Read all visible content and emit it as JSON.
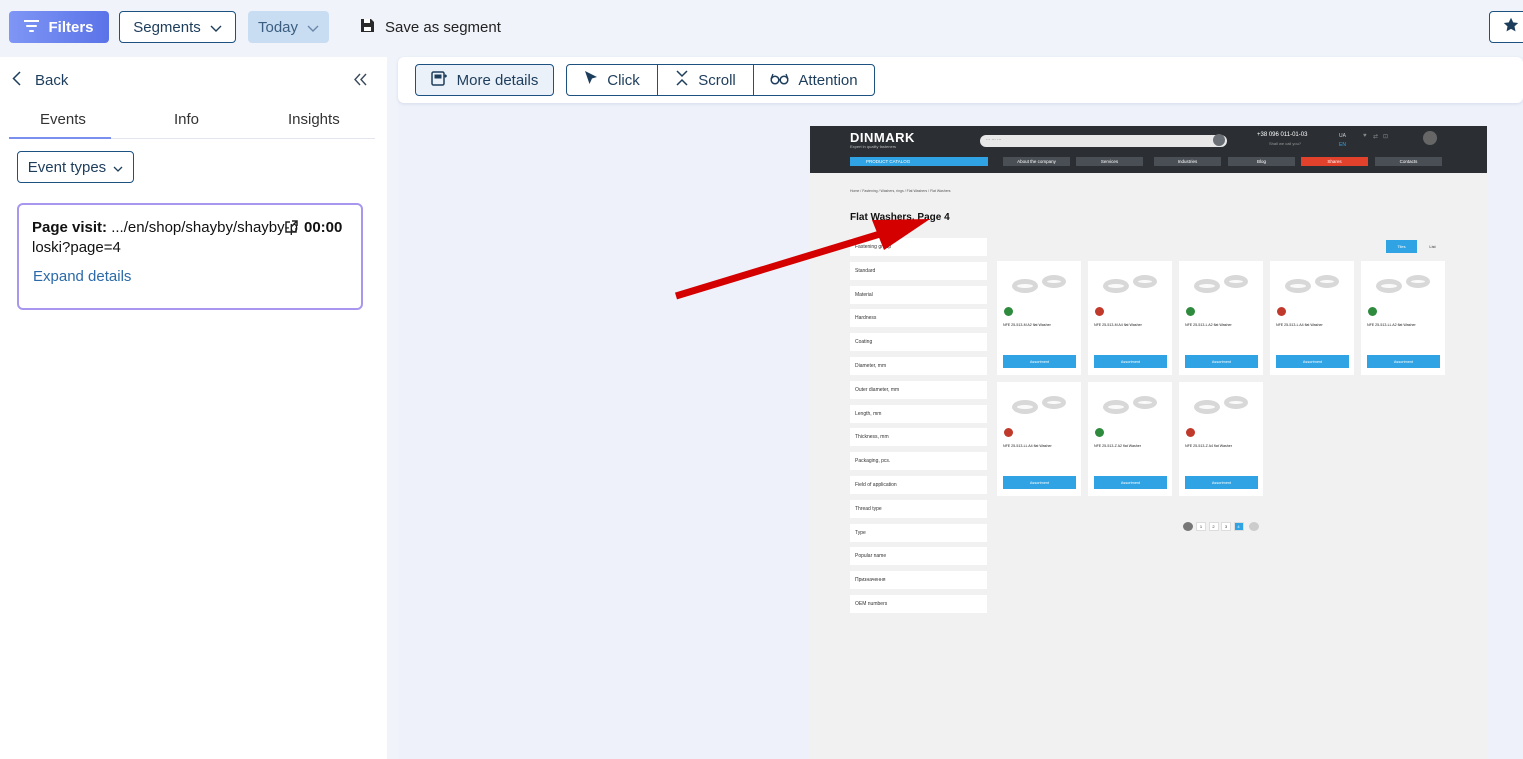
{
  "topbar": {
    "filters_label": "Filters",
    "segments_label": "Segments",
    "today_label": "Today",
    "save_segment_label": "Save as segment"
  },
  "left": {
    "back_label": "Back",
    "tabs": [
      "Events",
      "Info",
      "Insights"
    ],
    "active_tab": "Events",
    "event_types_label": "Event types",
    "event": {
      "prefix": "Page visit:",
      "url": " .../en/shop/shayby/shayby-p",
      "url_cont": "loski?page=4",
      "time": "00:00",
      "expand_label": "Expand details"
    }
  },
  "toolbar": {
    "more_details_label": "More details",
    "click_label": "Click",
    "scroll_label": "Scroll",
    "attention_label": "Attention"
  },
  "site": {
    "logo": "DINMARK",
    "logo_sub": "Expert in quality fasteners",
    "search_placeholder": "... ... ...",
    "phone": "+38 096 011-01-03",
    "phone_sub": "Shall we call you?",
    "lang_ua": "UA",
    "lang_en": "EN",
    "catalog_label": "PRODUCT CATALOG",
    "nav": [
      "About the company",
      "Services",
      "Industries",
      "Blog",
      "Shares",
      "Contacts"
    ],
    "breadcrumbs": "Home / Fastening / Washers, rings / Flat Washers / Flat Washers",
    "page_title": "Flat Washers. Page 4",
    "filters": [
      "Fastening group",
      "Standard",
      "Material",
      "Hardness",
      "Coating",
      "Diameter, mm",
      "Outer diameter, mm",
      "Length, mm",
      "Thickness, mm",
      "Packaging, pcs.",
      "Field of application",
      "Thread type",
      "Type",
      "Popular name",
      "Призначення",
      "OEM numbers"
    ],
    "tiles_label": "Tiles",
    "list_label": "List",
    "products": [
      {
        "name": "NFE 25-513-M A2 flat Washer",
        "badge": "A2",
        "badge_color": "#2e8b3e",
        "button": "Assortment"
      },
      {
        "name": "NFE 25-513-M A4 flat Washer",
        "badge": "A4",
        "badge_color": "#c0392b",
        "button": "Assortment"
      },
      {
        "name": "NFE 25-513-L A2 flat Washer",
        "badge": "A2",
        "badge_color": "#2e8b3e",
        "button": "Assortment"
      },
      {
        "name": "NFE 25-513-L A4 flat Washer",
        "badge": "A4",
        "badge_color": "#c0392b",
        "button": "Assortment"
      },
      {
        "name": "NFE 25-513-LL A2 flat Washer",
        "badge": "A2",
        "badge_color": "#2e8b3e",
        "button": "Assortment"
      },
      {
        "name": "NFE 25-513-LL A4 flat Washer",
        "badge": "A4",
        "badge_color": "#c0392b",
        "button": "Assortment"
      },
      {
        "name": "NFE 25-513-Z A2 flat Washer",
        "badge": "A2",
        "badge_color": "#2e8b3e",
        "button": "Assortment"
      },
      {
        "name": "NFE 25-513-Z A4 flat Washer",
        "badge": "A4",
        "badge_color": "#c0392b",
        "button": "Assortment"
      }
    ],
    "pages": [
      "1",
      "2",
      "3",
      "4"
    ],
    "current_page": "4"
  },
  "colors": {
    "accent": "#1d5180",
    "filters_gradient_start": "#7f96f5",
    "filters_gradient_end": "#5a73e8",
    "card_border": "#a997ef",
    "arrow": "#d40000",
    "site_blue": "#2fa3e3"
  },
  "icons": {
    "filters": "filter-lines-icon",
    "segments": "chevron-down-icon",
    "save": "floppy-disk-icon",
    "star": "star-icon",
    "back": "chevron-left-icon",
    "collapse": "double-chevron-left-icon",
    "external": "external-link-icon",
    "more_details": "details-panel-icon",
    "click": "cursor-icon",
    "scroll": "scroll-arrows-icon",
    "attention": "glasses-icon"
  }
}
